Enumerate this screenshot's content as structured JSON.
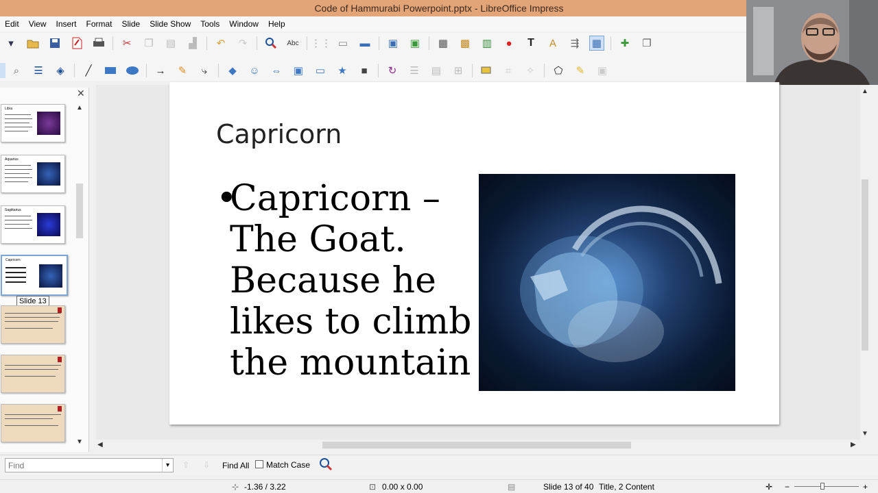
{
  "window": {
    "title": "Code of Hammurabi Powerpoint.pptx - LibreOffice Impress"
  },
  "menu": [
    "Edit",
    "View",
    "Insert",
    "Format",
    "Slide",
    "Slide Show",
    "Tools",
    "Window",
    "Help"
  ],
  "slide_panel": {
    "tooltip": "Slide 13",
    "thumb_titles": [
      "Libra",
      "Aquarius",
      "Sagittarius",
      "Capricorn"
    ]
  },
  "slide": {
    "title": "Capricorn",
    "bullet_symbol": "•",
    "body": "Capricorn – The Goat. Because he likes to climb the mountain"
  },
  "find_bar": {
    "placeholder": "Find",
    "find_all": "Find All",
    "match_case": "Match Case"
  },
  "status": {
    "position": "-1.36 / 3.22",
    "size": "0.00 x 0.00",
    "slide_info": "Slide 13 of 40",
    "layout": "Title, 2 Content"
  },
  "colors": {
    "title_bar": "#e3a577",
    "accent": "#7aa7d8"
  }
}
